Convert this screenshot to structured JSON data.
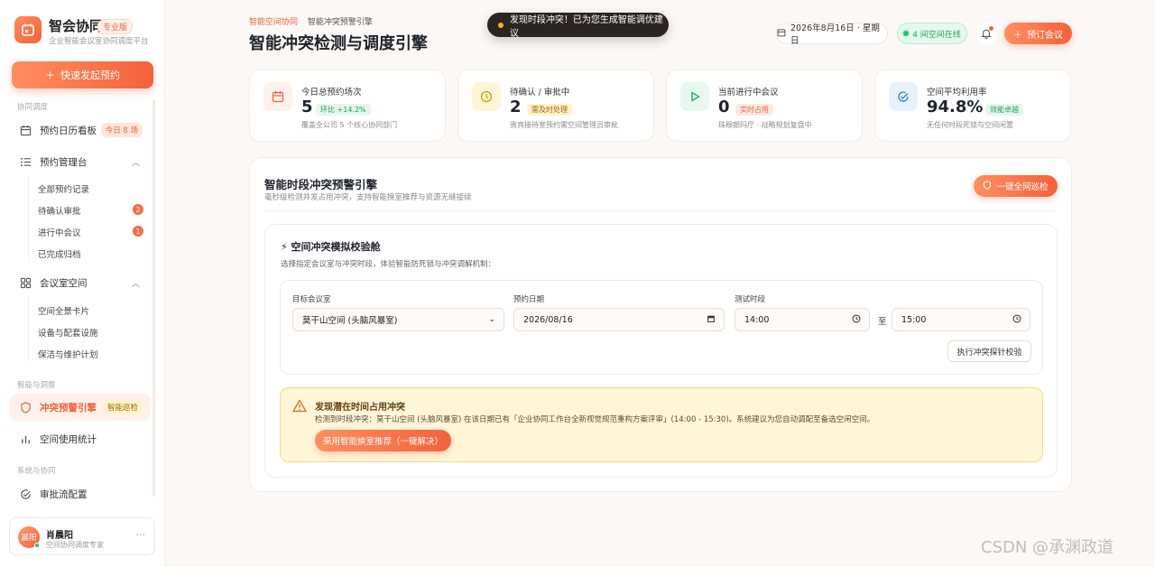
{
  "brand": {
    "name": "智会协同",
    "badge": "专业版",
    "subtitle": "企业智能会议室协同调度平台"
  },
  "quick_button": "快速发起预约",
  "sidebar": {
    "section1": "协同调度",
    "calendar": {
      "label": "预约日历看板",
      "badge": "今日 8 场"
    },
    "manage": {
      "label": "预约管理台",
      "subitems": [
        "全部预约记录",
        "待确认审批",
        "进行中会议",
        "已完成归档"
      ],
      "counts": [
        "2",
        "1"
      ]
    },
    "rooms": {
      "label": "会议室空间",
      "subitems": [
        "空间全景卡片",
        "设备与配套设施",
        "保洁与维护计划"
      ]
    },
    "section2": "智能与洞察",
    "conflict": {
      "label": "冲突预警引擎",
      "badge": "智能巡检"
    },
    "stats": {
      "label": "空间使用统计"
    },
    "section3": "系统与协同",
    "approval": {
      "label": "审批流配置"
    }
  },
  "user": {
    "avatar": "晨阳",
    "name": "肖晨阳",
    "role": "空间协同调度专家"
  },
  "breadcrumb": {
    "parent": "智能空间协同",
    "current": "智能冲突预警引擎"
  },
  "page_title": "智能冲突检测与调度引擎",
  "toast": "发现时段冲突！已为您生成智能调优建议",
  "header": {
    "date": "2026年8月16日 · 星期日",
    "online": "4 间空间在线",
    "book_button": "预订会议"
  },
  "stats": [
    {
      "title": "今日总预约场次",
      "value": "5",
      "tag": "环比 +14.2%",
      "desc": "覆盖全公司 5 个核心协同部门"
    },
    {
      "title": "待确认 / 审批中",
      "value": "2",
      "tag": "需及时处理",
      "desc": "贵宾接待室预约需空间管理员审批"
    },
    {
      "title": "当前进行中会议",
      "value": "0",
      "tag": "实时占用",
      "desc": "珠穆朗玛厅 · 战略规划复盘中"
    },
    {
      "title": "空间平均利用率",
      "value": "94.8%",
      "tag": "效能卓越",
      "desc": "无任何时段死锁与空间闲置"
    }
  ],
  "panel": {
    "title": "智能时段冲突预警引擎",
    "subtitle": "毫秒级检测并发占用冲突，支持智能换室推荐与资源无缝接续",
    "patrol_button": "一键全网巡检",
    "sim": {
      "title": "⚡ 空间冲突模拟校验舱",
      "subtitle": "选择指定会议室与冲突时段，体验智能防死锁与冲突调解机制：",
      "room_label": "目标会议室",
      "room_value": "莫干山空间 (头脑风暴室)",
      "date_label": "预约日期",
      "date_value": "2026/08/16",
      "time_label": "测试时段",
      "time_start": "14:00",
      "to": "至",
      "time_end": "15:00",
      "probe_button": "执行冲突探针校验"
    },
    "alert": {
      "title": "发现潜在时间占用冲突",
      "text": "检测到时段冲突：莫干山空间 (头脑风暴室) 在该日期已有「企业协同工作台全新视觉规范重构方案评审」(14:00 - 15:30)。系统建议为您自动调配至备选空闲空间。",
      "button": "采用智能换室推荐（一键解决）"
    }
  },
  "watermark": "CSDN @承渊政道",
  "colors": {
    "accent": "#f4623a",
    "success": "#21a35a",
    "warning_bg": "#fff6d8"
  }
}
